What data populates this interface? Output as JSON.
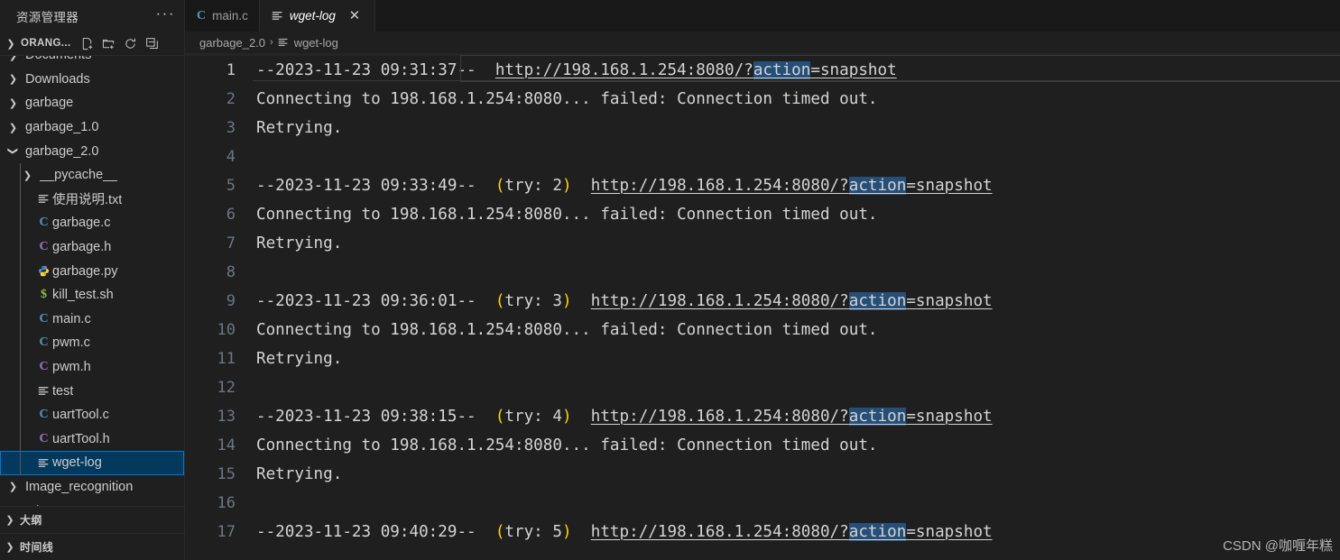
{
  "sidebar": {
    "title": "资源管理器",
    "more_label": "···",
    "section": {
      "name": "ORANG...",
      "chevron": "chevron-down",
      "actions": [
        {
          "name": "new-file",
          "label": "新建文件"
        },
        {
          "name": "new-folder",
          "label": "新建文件夹"
        },
        {
          "name": "refresh",
          "label": "刷新资源管理器"
        },
        {
          "name": "collapse-all",
          "label": "在资源管理器中折叠文件夹"
        }
      ]
    },
    "tree": [
      {
        "label": "Documents",
        "icon": "folder",
        "state": "collapsed",
        "depth": 1,
        "clipped": true
      },
      {
        "label": "Downloads",
        "icon": "folder",
        "state": "collapsed",
        "depth": 1
      },
      {
        "label": "garbage",
        "icon": "folder",
        "state": "collapsed",
        "depth": 1
      },
      {
        "label": "garbage_1.0",
        "icon": "folder",
        "state": "collapsed",
        "depth": 1
      },
      {
        "label": "garbage_2.0",
        "icon": "folder",
        "state": "expanded",
        "depth": 1
      },
      {
        "label": "__pycache__",
        "icon": "folder",
        "state": "collapsed",
        "depth": 2
      },
      {
        "label": "使用说明.txt",
        "icon": "text-file-icon",
        "state": "file",
        "depth": 2
      },
      {
        "label": "garbage.c",
        "icon": "c-file-icon",
        "state": "file",
        "depth": 2
      },
      {
        "label": "garbage.h",
        "icon": "h-file-icon",
        "state": "file",
        "depth": 2
      },
      {
        "label": "garbage.py",
        "icon": "python-file-icon",
        "state": "file",
        "depth": 2
      },
      {
        "label": "kill_test.sh",
        "icon": "shell-file-icon",
        "state": "file",
        "depth": 2
      },
      {
        "label": "main.c",
        "icon": "c-file-icon",
        "state": "file",
        "depth": 2
      },
      {
        "label": "pwm.c",
        "icon": "c-file-icon",
        "state": "file",
        "depth": 2
      },
      {
        "label": "pwm.h",
        "icon": "h-file-icon",
        "state": "file",
        "depth": 2
      },
      {
        "label": "test",
        "icon": "text-file-icon",
        "state": "file",
        "depth": 2
      },
      {
        "label": "uartTool.c",
        "icon": "c-file-icon",
        "state": "file",
        "depth": 2
      },
      {
        "label": "uartTool.h",
        "icon": "h-file-icon",
        "state": "file",
        "depth": 2
      },
      {
        "label": "wget-log",
        "icon": "text-file-icon",
        "state": "file",
        "depth": 2,
        "selected": true
      },
      {
        "label": "Image_recognition",
        "icon": "folder",
        "state": "collapsed",
        "depth": 1
      },
      {
        "label": "ming-streamer",
        "icon": "folder",
        "state": "collapsed",
        "depth": 1,
        "git": "untracked",
        "clipped": true
      }
    ],
    "panes": [
      {
        "label": "大纲",
        "state": "collapsed"
      },
      {
        "label": "时间线",
        "state": "collapsed"
      }
    ]
  },
  "tabs": [
    {
      "label": "main.c",
      "icon": "c-file-icon",
      "active": false,
      "italic": false,
      "closable": false
    },
    {
      "label": "wget-log",
      "icon": "text-file-icon",
      "active": true,
      "italic": true,
      "closable": true,
      "close_glyph": "✕"
    }
  ],
  "breadcrumb": {
    "folder": "garbage_2.0",
    "separator": "›",
    "file": "wget-log",
    "file_icon": "text-file-icon"
  },
  "editor": {
    "colors": {
      "background": "#1f1f1f",
      "foreground": "#d4d4d4",
      "line_number": "#6e7681",
      "line_number_active": "#cccccc",
      "bracket": "#ffd700",
      "find_match_highlight": "#264f78",
      "selection_border": "#3a3a3a"
    },
    "lines": [
      {
        "n": 1,
        "active": true,
        "segments": [
          {
            "t": "--2023-11-23 09:31:37--  "
          },
          {
            "t": "http://198.168.1.254:8080/?",
            "k": "link"
          },
          {
            "t": "action",
            "k": "find"
          },
          {
            "t": "=snapshot",
            "k": "link"
          }
        ]
      },
      {
        "n": 2,
        "segments": [
          {
            "t": "Connecting to 198.168.1.254:8080... failed: Connection timed out."
          }
        ]
      },
      {
        "n": 3,
        "segments": [
          {
            "t": "Retrying."
          }
        ]
      },
      {
        "n": 4,
        "segments": [
          {
            "t": ""
          }
        ]
      },
      {
        "n": 5,
        "segments": [
          {
            "t": "--2023-11-23 09:33:49--  "
          },
          {
            "t": "(",
            "k": "bracket"
          },
          {
            "t": "try: 2"
          },
          {
            "t": ")",
            "k": "bracket"
          },
          {
            "t": "  "
          },
          {
            "t": "http://198.168.1.254:8080/?",
            "k": "link"
          },
          {
            "t": "action",
            "k": "find"
          },
          {
            "t": "=snapshot",
            "k": "link"
          }
        ]
      },
      {
        "n": 6,
        "segments": [
          {
            "t": "Connecting to 198.168.1.254:8080... failed: Connection timed out."
          }
        ]
      },
      {
        "n": 7,
        "segments": [
          {
            "t": "Retrying."
          }
        ]
      },
      {
        "n": 8,
        "segments": [
          {
            "t": ""
          }
        ]
      },
      {
        "n": 9,
        "segments": [
          {
            "t": "--2023-11-23 09:36:01--  "
          },
          {
            "t": "(",
            "k": "bracket"
          },
          {
            "t": "try: 3"
          },
          {
            "t": ")",
            "k": "bracket"
          },
          {
            "t": "  "
          },
          {
            "t": "http://198.168.1.254:8080/?",
            "k": "link"
          },
          {
            "t": "action",
            "k": "find"
          },
          {
            "t": "=snapshot",
            "k": "link"
          }
        ]
      },
      {
        "n": 10,
        "segments": [
          {
            "t": "Connecting to 198.168.1.254:8080... failed: Connection timed out."
          }
        ]
      },
      {
        "n": 11,
        "segments": [
          {
            "t": "Retrying."
          }
        ]
      },
      {
        "n": 12,
        "segments": [
          {
            "t": ""
          }
        ]
      },
      {
        "n": 13,
        "segments": [
          {
            "t": "--2023-11-23 09:38:15--  "
          },
          {
            "t": "(",
            "k": "bracket"
          },
          {
            "t": "try: 4"
          },
          {
            "t": ")",
            "k": "bracket"
          },
          {
            "t": "  "
          },
          {
            "t": "http://198.168.1.254:8080/?",
            "k": "link"
          },
          {
            "t": "action",
            "k": "find"
          },
          {
            "t": "=snapshot",
            "k": "link"
          }
        ]
      },
      {
        "n": 14,
        "segments": [
          {
            "t": "Connecting to 198.168.1.254:8080... failed: Connection timed out."
          }
        ]
      },
      {
        "n": 15,
        "segments": [
          {
            "t": "Retrying."
          }
        ]
      },
      {
        "n": 16,
        "segments": [
          {
            "t": ""
          }
        ]
      },
      {
        "n": 17,
        "segments": [
          {
            "t": "--2023-11-23 09:40:29--  "
          },
          {
            "t": "(",
            "k": "bracket"
          },
          {
            "t": "try: 5"
          },
          {
            "t": ")",
            "k": "bracket"
          },
          {
            "t": "  "
          },
          {
            "t": "http://198.168.1.254:8080/?",
            "k": "link"
          },
          {
            "t": "action",
            "k": "find"
          },
          {
            "t": "=snapshot",
            "k": "link"
          }
        ]
      }
    ]
  },
  "watermark": "CSDN @咖喱年糕"
}
